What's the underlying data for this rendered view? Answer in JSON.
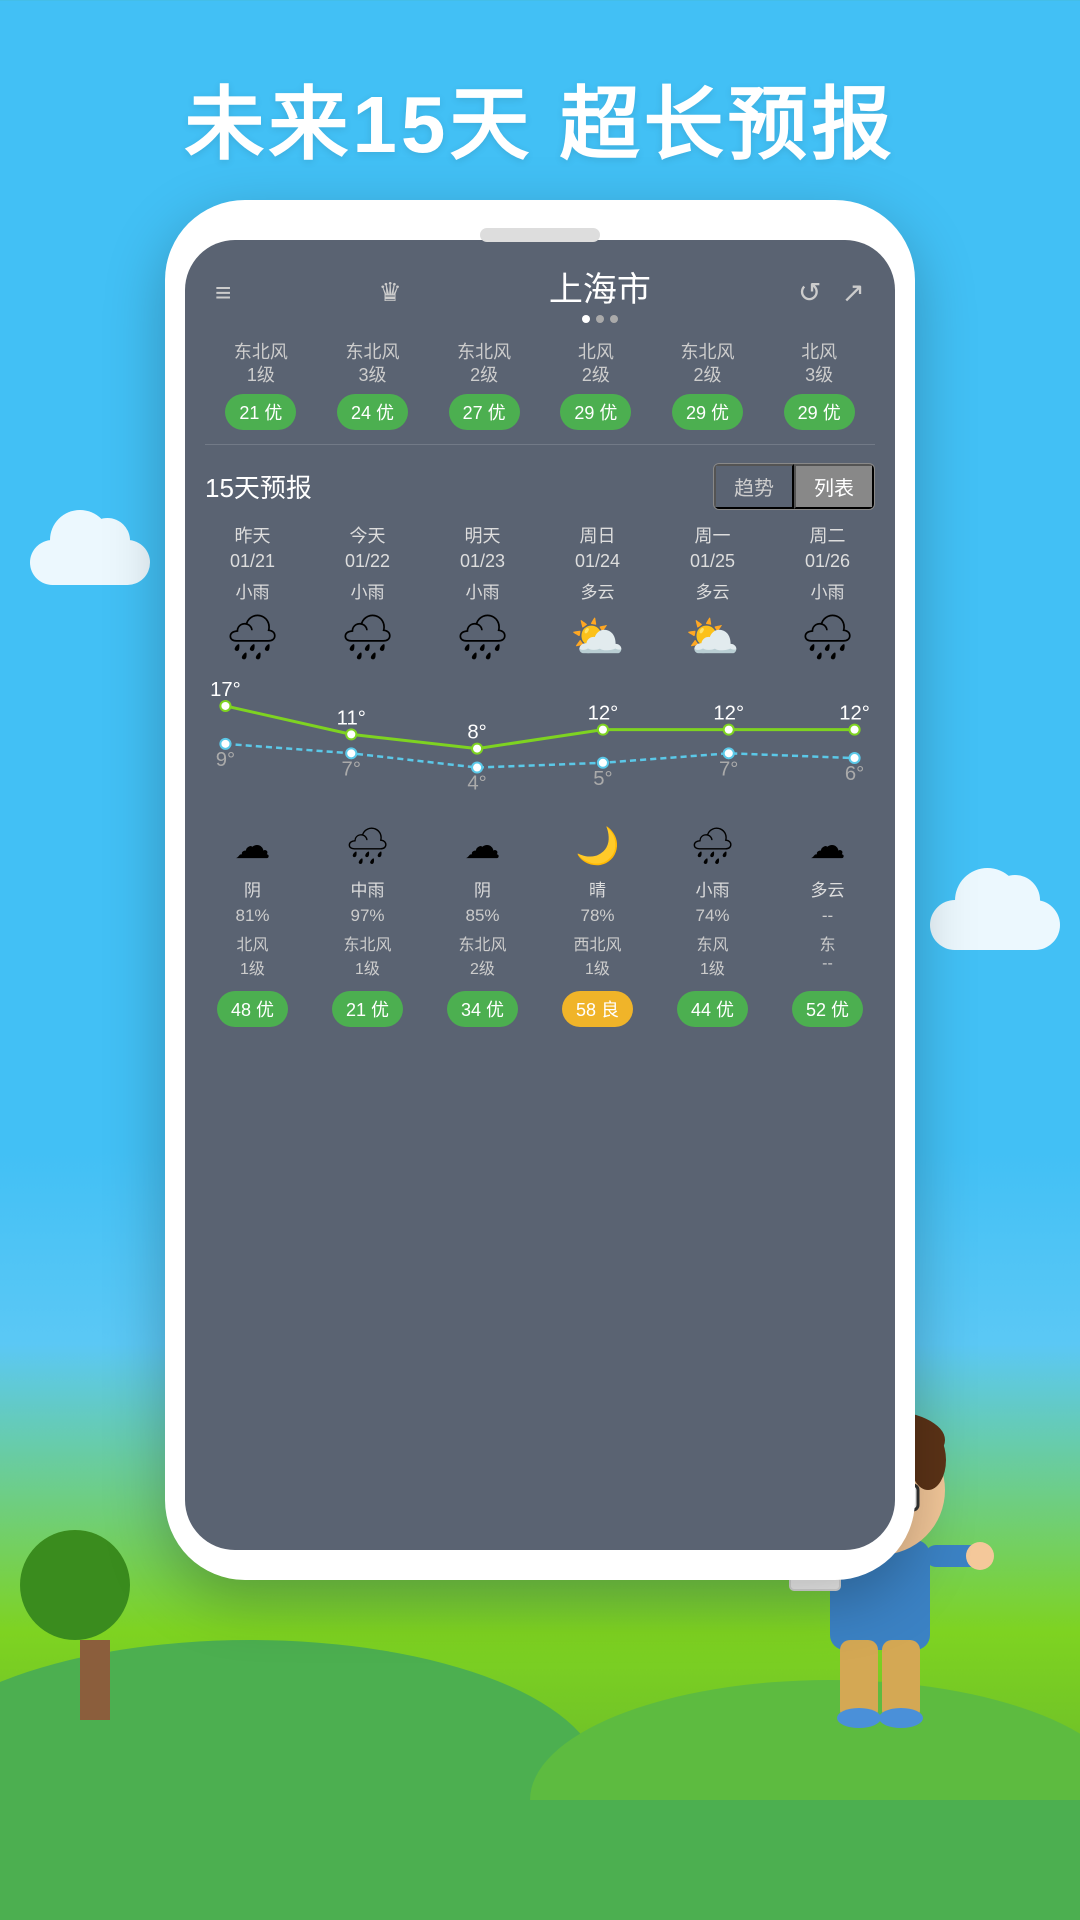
{
  "page": {
    "header_title": "未来15天  超长预报",
    "city": "上海市",
    "section_15day": "15天预报",
    "tab_trend": "趋势",
    "tab_list": "列表"
  },
  "nav": {
    "menu_icon": "≡",
    "crown_icon": "♛",
    "refresh_icon": "↺",
    "share_icon": "↗",
    "dots": [
      "active",
      "inactive",
      "inactive"
    ]
  },
  "aqi_top": [
    {
      "wind": "东北风\n1级",
      "aqi": "21 优",
      "color": "green"
    },
    {
      "wind": "东北风\n3级",
      "aqi": "24 优",
      "color": "green"
    },
    {
      "wind": "东北风\n2级",
      "aqi": "27 优",
      "color": "green"
    },
    {
      "wind": "北风\n2级",
      "aqi": "29 优",
      "color": "green"
    },
    {
      "wind": "东北风\n2级",
      "aqi": "29 优",
      "color": "green"
    },
    {
      "wind": "北风\n3级",
      "aqi": "29 优",
      "color": "green"
    }
  ],
  "forecast": [
    {
      "day": "昨天\n01/21",
      "cond": "小雨",
      "icon": "🌧",
      "high": 17,
      "low": 9,
      "night_icon": "☁",
      "night_cond": "阴",
      "pct": "81%",
      "wind": "北风\n1级",
      "aqi": "48 优",
      "aqi_color": "green"
    },
    {
      "day": "今天\n01/22",
      "cond": "小雨",
      "icon": "🌧",
      "high": 11,
      "low": 7,
      "night_icon": "🌧",
      "night_cond": "中雨",
      "pct": "97%",
      "wind": "东北风\n1级",
      "aqi": "21 优",
      "aqi_color": "green"
    },
    {
      "day": "明天\n01/23",
      "cond": "小雨",
      "icon": "🌧",
      "high": 8,
      "low": 4,
      "night_icon": "☁",
      "night_cond": "阴",
      "pct": "85%",
      "wind": "东北风\n2级",
      "aqi": "34 优",
      "aqi_color": "green"
    },
    {
      "day": "周日\n01/24",
      "cond": "多云",
      "icon": "⛅",
      "high": 12,
      "low": 5,
      "night_icon": "🌙",
      "night_cond": "晴",
      "pct": "78%",
      "wind": "西北风\n1级",
      "aqi": "58 良",
      "aqi_color": "yellow"
    },
    {
      "day": "周一\n01/25",
      "cond": "多云",
      "icon": "⛅",
      "high": 12,
      "low": 7,
      "night_icon": "🌧",
      "night_cond": "小雨",
      "pct": "74%",
      "wind": "东风\n1级",
      "aqi": "44 优",
      "aqi_color": "green"
    },
    {
      "day": "周二\n01/26",
      "cond": "小雨",
      "icon": "🌧",
      "high": 12,
      "low": 6,
      "night_icon": "☁",
      "night_cond": "多云",
      "pct": "--",
      "wind": "东\n--",
      "aqi": "52 优",
      "aqi_color": "green"
    }
  ],
  "chart": {
    "high_temps": [
      17,
      11,
      8,
      12,
      12,
      12
    ],
    "low_temps": [
      9,
      7,
      4,
      5,
      7,
      6
    ],
    "high_color": "#7ED321",
    "low_color": "#5BC8E8"
  }
}
